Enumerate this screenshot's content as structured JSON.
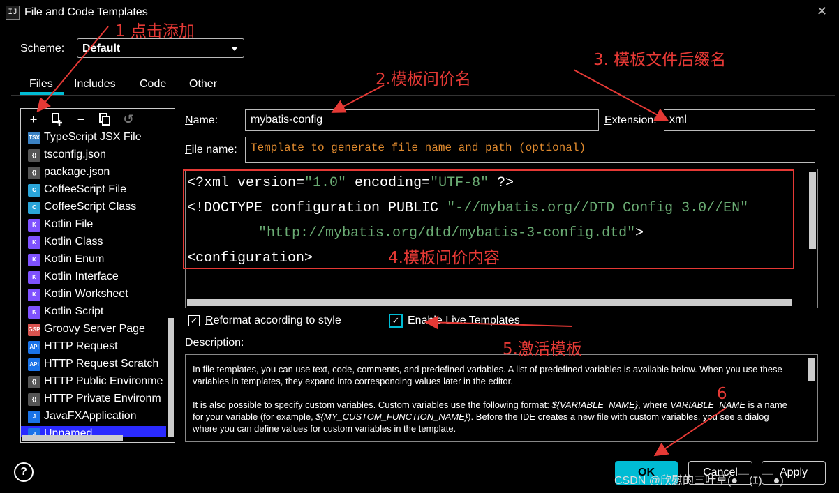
{
  "window": {
    "title": "File and Code Templates",
    "app_icon_text": "IJ",
    "close_icon": "close-icon"
  },
  "scheme": {
    "label": "Scheme:",
    "value": "Default"
  },
  "tabs": [
    {
      "label": "Files",
      "active": true
    },
    {
      "label": "Includes",
      "active": false
    },
    {
      "label": "Code",
      "active": false
    },
    {
      "label": "Other",
      "active": false
    }
  ],
  "toolbar": {
    "icons": [
      "add-icon",
      "add-child-icon",
      "remove-icon",
      "copy-icon",
      "reset-icon"
    ]
  },
  "templates": [
    {
      "label": "TypeScript JSX File",
      "icon": "TSX"
    },
    {
      "label": "tsconfig.json",
      "icon": "{}"
    },
    {
      "label": "package.json",
      "icon": "{}"
    },
    {
      "label": "CoffeeScript File",
      "icon": "C"
    },
    {
      "label": "CoffeeScript Class",
      "icon": "C"
    },
    {
      "label": "Kotlin File",
      "icon": "K"
    },
    {
      "label": "Kotlin Class",
      "icon": "K"
    },
    {
      "label": "Kotlin Enum",
      "icon": "K"
    },
    {
      "label": "Kotlin Interface",
      "icon": "K"
    },
    {
      "label": "Kotlin Worksheet",
      "icon": "K"
    },
    {
      "label": "Kotlin Script",
      "icon": "K"
    },
    {
      "label": "Groovy Server Page",
      "icon": "GSP"
    },
    {
      "label": "HTTP Request",
      "icon": "API"
    },
    {
      "label": "HTTP Request Scratch",
      "icon": "API"
    },
    {
      "label": "HTTP Public Environme",
      "icon": "{}"
    },
    {
      "label": "HTTP Private Environm",
      "icon": "{}"
    },
    {
      "label": "JavaFXApplication",
      "icon": "J"
    },
    {
      "label": "Unnamed",
      "icon": "J",
      "selected": true
    }
  ],
  "form": {
    "name_label_prefix": "N",
    "name_label_rest": "ame:",
    "name_value": "mybatis-config",
    "extension_label_prefix": "E",
    "extension_label_rest": "xtension:",
    "extension_value": "xml",
    "filename_label_prefix": "F",
    "filename_label_rest": "ile name:",
    "filename_placeholder": "Template to generate file name and path (optional)"
  },
  "editor": {
    "line1_a": "<?xml version=",
    "line1_s1": "\"1.0\"",
    "line1_b": " encoding=",
    "line1_s2": "\"UTF-8\"",
    "line1_c": " ?>",
    "line2_a": "<!DOCTYPE configuration PUBLIC ",
    "line2_s": "\"-//mybatis.org//DTD Config 3.0//EN\"",
    "line3_s": "\"http://mybatis.org/dtd/mybatis-3-config.dtd\"",
    "line3_c": ">",
    "line4": "<configuration>"
  },
  "options": {
    "reformat_prefix": "R",
    "reformat_rest": "eformat according to style",
    "reformat_checked": true,
    "live_templates_label": "Enable Live Templates",
    "live_templates_checked": true
  },
  "description": {
    "label": "Description:",
    "p1": "In file templates, you can use text, code, comments, and predefined variables. A list of predefined variables is available below. When you use these variables in templates, they expand into corresponding values later in the editor.",
    "p2_a": "It is also possible to specify custom variables. Custom variables use the following format: ",
    "p2_var1": "${VARIABLE_NAME}",
    "p2_b": ", where ",
    "p2_var2": "VARIABLE_NAME",
    "p2_c": " is a name for your variable (for example, ",
    "p2_var3": "${MY_CUSTOM_FUNCTION_NAME}",
    "p2_d": "). Before the IDE creates a new file with custom variables, you see a dialog where you can define values for custom variables in the template."
  },
  "buttons": {
    "help": "?",
    "ok": "OK",
    "cancel": "Cancel",
    "apply": "Apply"
  },
  "annotations": {
    "a1": "1 点击添加",
    "a2": "2.模板问价名",
    "a3": "3. 模板文件后缀名",
    "a4": "4.模板问价内容",
    "a5": "5.激活模板",
    "a6": "6",
    "color": "#e53935"
  },
  "watermark": "CSDN @欣慰的三叶草(●￣(ｴ)￣●)",
  "colors": {
    "accent": "#00bcd4",
    "selection": "#2a2aff",
    "string": "#6aab73",
    "placeholder": "#e08a2e"
  }
}
